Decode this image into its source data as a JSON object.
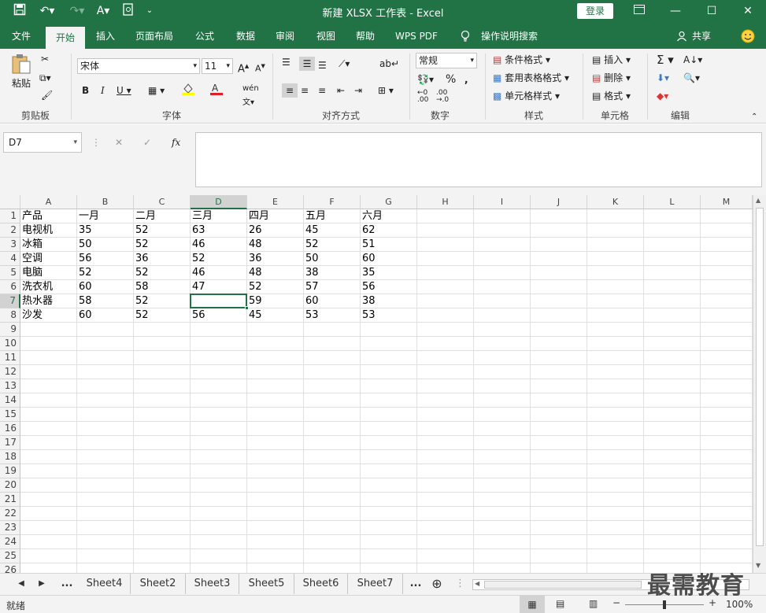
{
  "title": "新建 XLSX 工作表  -  Excel",
  "login_label": "登录",
  "tabs": [
    "文件",
    "开始",
    "插入",
    "页面布局",
    "公式",
    "数据",
    "审阅",
    "视图",
    "帮助",
    "WPS PDF"
  ],
  "active_tab": "开始",
  "tell_me": "操作说明搜索",
  "share": "共享",
  "ribbon": {
    "paste_label": "粘贴",
    "font_name": "宋体",
    "font_size": "11",
    "number_format": "常规",
    "cond_format": "条件格式",
    "table_format": "套用表格格式",
    "cell_style": "单元格样式",
    "insert": "插入",
    "delete": "删除",
    "format": "格式",
    "groups": [
      "剪贴板",
      "字体",
      "对齐方式",
      "数字",
      "样式",
      "单元格",
      "编辑"
    ]
  },
  "name_box": "D7",
  "formula_content": "",
  "columns": [
    "A",
    "B",
    "C",
    "D",
    "E",
    "F",
    "G",
    "H",
    "I",
    "J",
    "K",
    "L",
    "M"
  ],
  "selected_column": "D",
  "selected_row": 7,
  "rows": [
    [
      "产品",
      "一月",
      "二月",
      "三月",
      "四月",
      "五月",
      "六月"
    ],
    [
      "电视机",
      "35",
      "52",
      "63",
      "26",
      "45",
      "62"
    ],
    [
      "冰箱",
      "50",
      "52",
      "46",
      "48",
      "52",
      "51"
    ],
    [
      "空调",
      "56",
      "36",
      "52",
      "36",
      "50",
      "60"
    ],
    [
      "电脑",
      "52",
      "52",
      "46",
      "48",
      "38",
      "35"
    ],
    [
      "洗衣机",
      "60",
      "58",
      "47",
      "52",
      "57",
      "56"
    ],
    [
      "热水器",
      "58",
      "52",
      "",
      "59",
      "60",
      "38"
    ],
    [
      "沙发",
      "60",
      "52",
      "56",
      "45",
      "53",
      "53"
    ]
  ],
  "row_numbers": [
    "1",
    "2",
    "3",
    "4",
    "5",
    "6",
    "7",
    "8",
    "9",
    "10",
    "11",
    "12",
    "13",
    "14",
    "15",
    "16",
    "17",
    "18",
    "19",
    "20",
    "21",
    "22",
    "23",
    "24",
    "25",
    "26"
  ],
  "sheets": [
    "Sheet4",
    "Sheet2",
    "Sheet3",
    "Sheet5",
    "Sheet6",
    "Sheet7"
  ],
  "status": "就绪",
  "zoom": "100%",
  "watermark": "最需教育"
}
